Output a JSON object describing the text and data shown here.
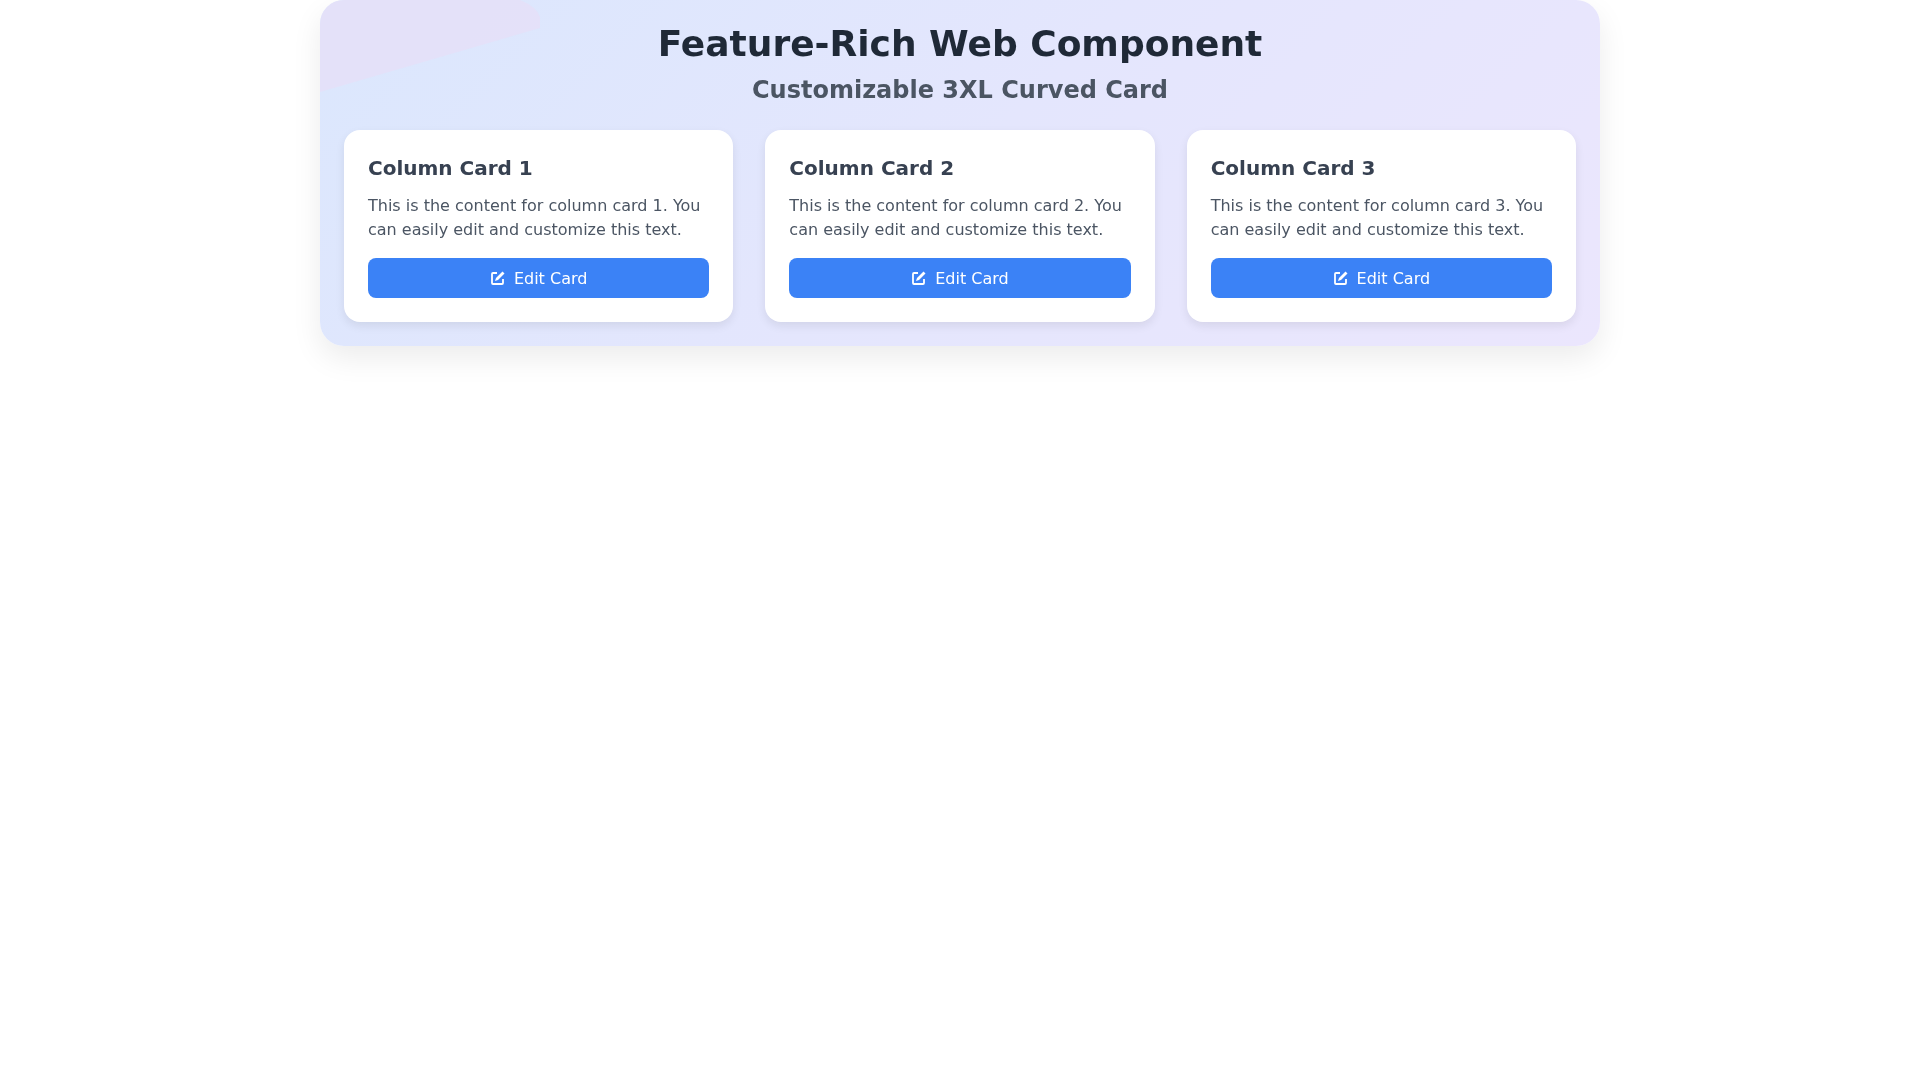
{
  "header": {
    "title": "Feature-Rich Web Component",
    "subtitle": "Customizable 3XL Curved Card"
  },
  "cards": [
    {
      "title": "Column Card 1",
      "text": "This is the content for column card 1. You can easily edit and customize this text.",
      "button": "Edit Card"
    },
    {
      "title": "Column Card 2",
      "text": "This is the content for column card 2. You can easily edit and customize this text.",
      "button": "Edit Card"
    },
    {
      "title": "Column Card 3",
      "text": "This is the content for column card 3. You can easily edit and customize this text.",
      "button": "Edit Card"
    }
  ]
}
